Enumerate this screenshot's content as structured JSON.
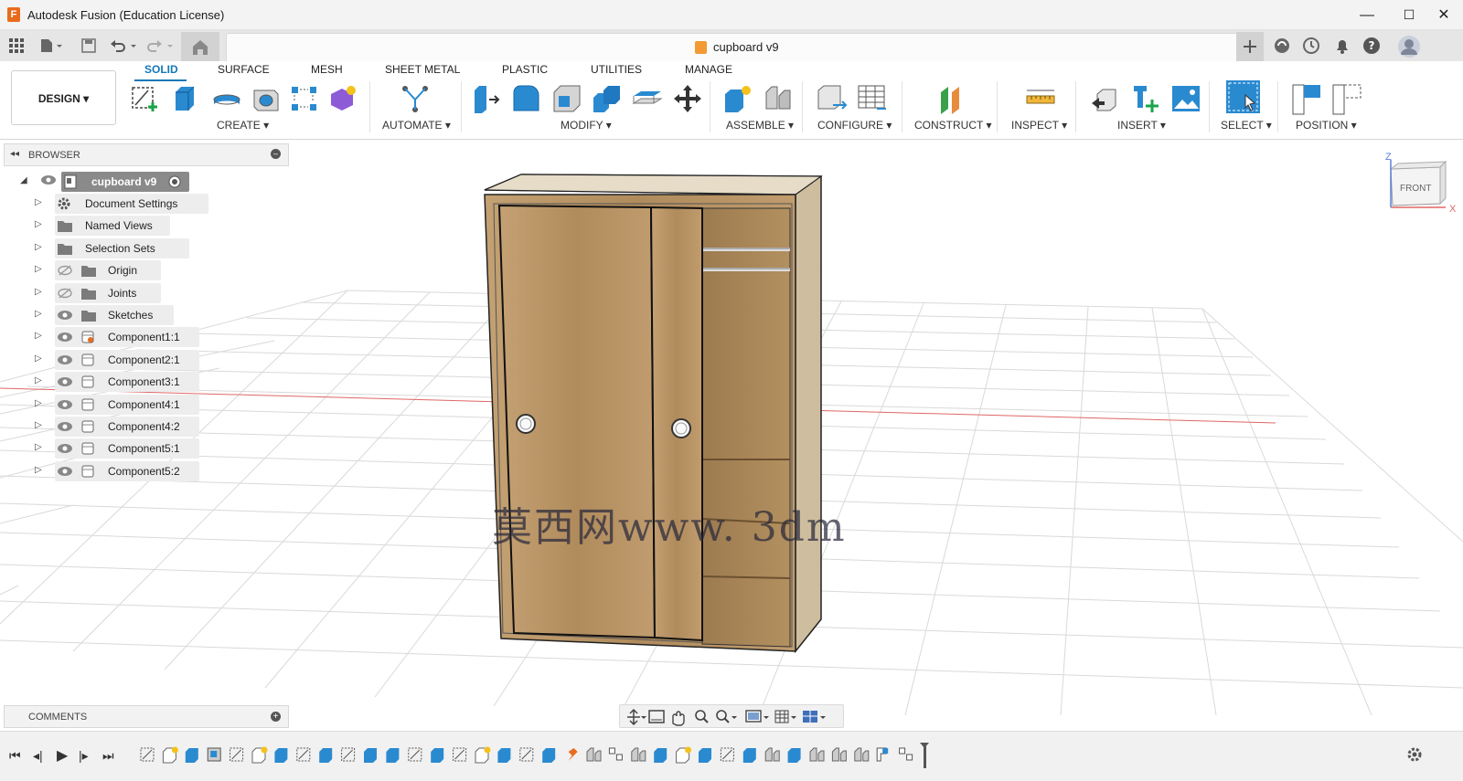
{
  "window": {
    "title": "Autodesk Fusion (Education License)",
    "app_icon": "F",
    "controls": [
      "minimize-icon",
      "maximize-icon",
      "close-icon"
    ]
  },
  "quick_access": [
    "grid-apps-icon",
    "file-icon",
    "save-icon",
    "undo-icon",
    "redo-icon",
    "home-icon"
  ],
  "document_tab": {
    "name": "cupboard v9",
    "close": "✕"
  },
  "right_icons": [
    "new-tab-icon",
    "extensions-icon",
    "job-status-icon",
    "notifications-icon",
    "help-icon",
    "avatar"
  ],
  "ribbon": {
    "workspace": "DESIGN",
    "tabs": [
      "SOLID",
      "SURFACE",
      "MESH",
      "SHEET METAL",
      "PLASTIC",
      "UTILITIES",
      "MANAGE"
    ],
    "active_tab": "SOLID",
    "groups": [
      "CREATE",
      "AUTOMATE",
      "MODIFY",
      "ASSEMBLE",
      "CONFIGURE",
      "CONSTRUCT",
      "INSPECT",
      "INSERT",
      "SELECT",
      "POSITION"
    ]
  },
  "browser": {
    "title": "BROWSER",
    "root": "cupboard v9",
    "items": [
      {
        "label": "Document Settings",
        "icon": "gear-icon"
      },
      {
        "label": "Named Views",
        "icon": "folder-icon"
      },
      {
        "label": "Selection Sets",
        "icon": "folder-icon"
      },
      {
        "label": "Origin",
        "icon": "folder-icon",
        "visibility": "hidden"
      },
      {
        "label": "Joints",
        "icon": "folder-icon",
        "visibility": "hidden"
      },
      {
        "label": "Sketches",
        "icon": "folder-icon",
        "visibility": "visible"
      },
      {
        "label": "Component1:1",
        "icon": "component-icon",
        "visibility": "visible"
      },
      {
        "label": "Component2:1",
        "icon": "component-icon",
        "visibility": "visible"
      },
      {
        "label": "Component3:1",
        "icon": "component-icon",
        "visibility": "visible"
      },
      {
        "label": "Component4:1",
        "icon": "component-icon",
        "visibility": "visible"
      },
      {
        "label": "Component4:2",
        "icon": "component-icon",
        "visibility": "visible"
      },
      {
        "label": "Component5:1",
        "icon": "component-icon",
        "visibility": "visible"
      },
      {
        "label": "Component5:2",
        "icon": "component-icon",
        "visibility": "visible"
      }
    ]
  },
  "comments": {
    "title": "COMMENTS"
  },
  "viewcube": {
    "face": "FRONT",
    "axis_z": "Z",
    "axis_x": "X"
  },
  "watermark": "莫西网www. 3dm",
  "colors": {
    "accent": "#1478b8",
    "wood": "#b79265",
    "grid": "#d9d9d9",
    "axis_red": "#e06666",
    "axis_green": "#7cbf6b"
  },
  "navbar": [
    "orbit-icon",
    "look-at-icon",
    "pan-icon",
    "zoom-icon",
    "zoom-window-icon",
    "display-settings-icon",
    "grid-settings-icon",
    "viewports-icon"
  ],
  "timeline": {
    "controls": [
      "skip-start-icon",
      "step-back-icon",
      "play-icon",
      "step-forward-icon",
      "skip-end-icon"
    ],
    "feature_count": 36,
    "settings": "gear-icon"
  }
}
